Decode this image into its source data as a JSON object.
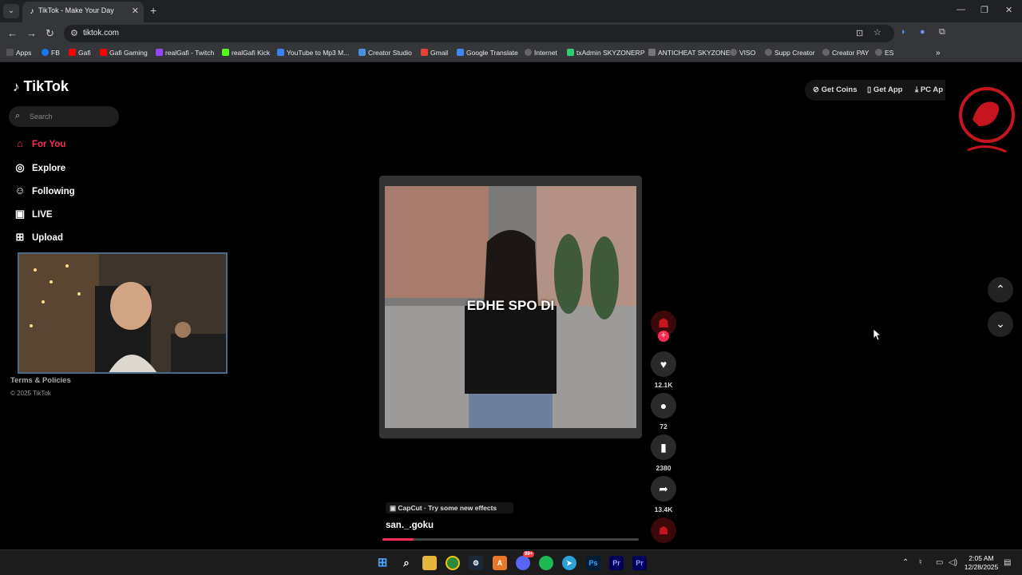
{
  "browser": {
    "tab_title": "TikTok - Make Your Day",
    "url": "tiktok.com",
    "bookmarks": [
      {
        "label": "Apps",
        "color": "#e8eaed"
      },
      {
        "label": "FB",
        "color": "#1877f2"
      },
      {
        "label": "Gafi",
        "color": "#ff0000"
      },
      {
        "label": "Gafi Gaming",
        "color": "#ff0000"
      },
      {
        "label": "realGafi - Twitch",
        "color": "#9146ff"
      },
      {
        "label": "realGafi Kick",
        "color": "#53fc18"
      },
      {
        "label": "YouTube to Mp3 M...",
        "color": "#3b82f6"
      },
      {
        "label": "Creator Studio",
        "color": "#4a90e2"
      },
      {
        "label": "Gmail",
        "color": "#ea4335"
      },
      {
        "label": "Google Translate",
        "color": "#4285f4"
      },
      {
        "label": "Internet",
        "color": "#cccccc"
      },
      {
        "label": "txAdmin SKYZONERP",
        "color": "#2ecc71"
      },
      {
        "label": "ANTICHEAT SKYZONE",
        "color": "#999999"
      },
      {
        "label": "VISO",
        "color": "#cccccc"
      },
      {
        "label": "Supp Creator",
        "color": "#cccccc"
      },
      {
        "label": "Creator PAY",
        "color": "#cccccc"
      },
      {
        "label": "ES",
        "color": "#cccccc"
      }
    ]
  },
  "tiktok": {
    "logo": "TikTok",
    "search_placeholder": "Search",
    "nav": [
      {
        "label": "For You",
        "icon": "home-icon",
        "active": true
      },
      {
        "label": "Explore",
        "icon": "compass-icon",
        "active": false
      },
      {
        "label": "Following",
        "icon": "user-icon",
        "active": false
      },
      {
        "label": "LIVE",
        "icon": "live-icon",
        "active": false
      },
      {
        "label": "Upload",
        "icon": "plus-box-icon",
        "active": false
      }
    ],
    "footer": {
      "terms": "Terms & Policies",
      "copyright": "© 2025 TikTok"
    },
    "top_actions": {
      "get_coins": "Get Coins",
      "get_app": "Get App",
      "pc_app": "PC Ap"
    },
    "video": {
      "caption_overlay": "EDHE SPO DI",
      "effect_label": "CapCut · Try some new effects",
      "author": "san._.goku",
      "progress": 0.12
    },
    "actions": {
      "likes": "12.1K",
      "comments": "72",
      "saves": "2380",
      "shares": "13.4K"
    },
    "accent_color": "#fe2c55"
  },
  "taskbar": {
    "clock_time": "2:05 AM",
    "clock_date": "12/28/2025",
    "discord_badge": "99+"
  }
}
